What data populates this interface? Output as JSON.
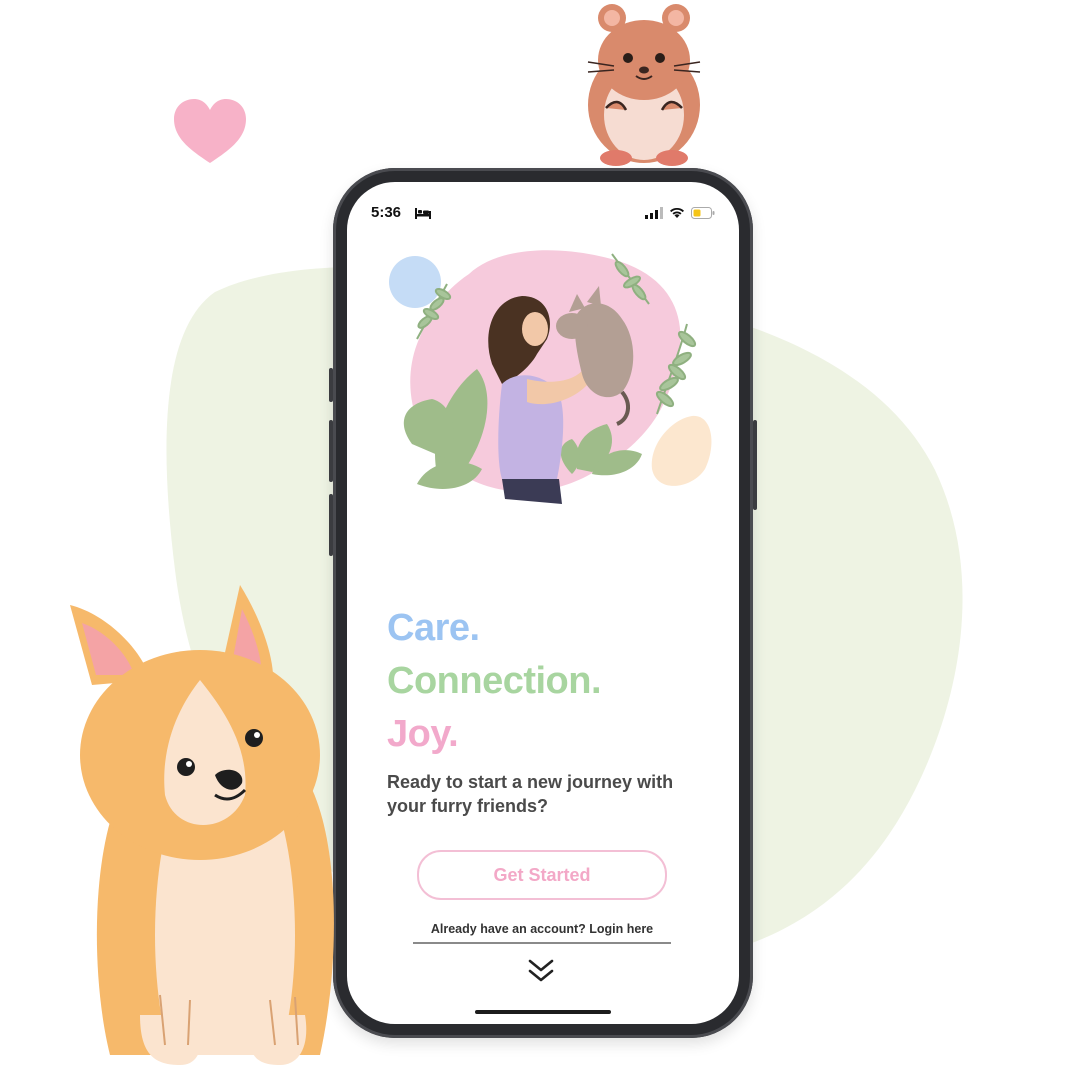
{
  "status_bar": {
    "time": "5:36"
  },
  "headline": {
    "line1": "Care.",
    "line2": "Connection.",
    "line3": "Joy."
  },
  "subtitle": "Ready to start a new journey with your furry friends?",
  "cta": {
    "get_started": "Get Started"
  },
  "login_link": "Already have an account? Login here",
  "colors": {
    "care": "#9cc4f2",
    "connection": "#a8d5a0",
    "joy": "#f2a9cb",
    "button_border": "#f3bfd5",
    "background_blob": "#eef3e3"
  },
  "icons": [
    "heart-icon",
    "bed-icon",
    "signal-icon",
    "wifi-icon",
    "battery-icon",
    "double-chevron-down-icon"
  ]
}
